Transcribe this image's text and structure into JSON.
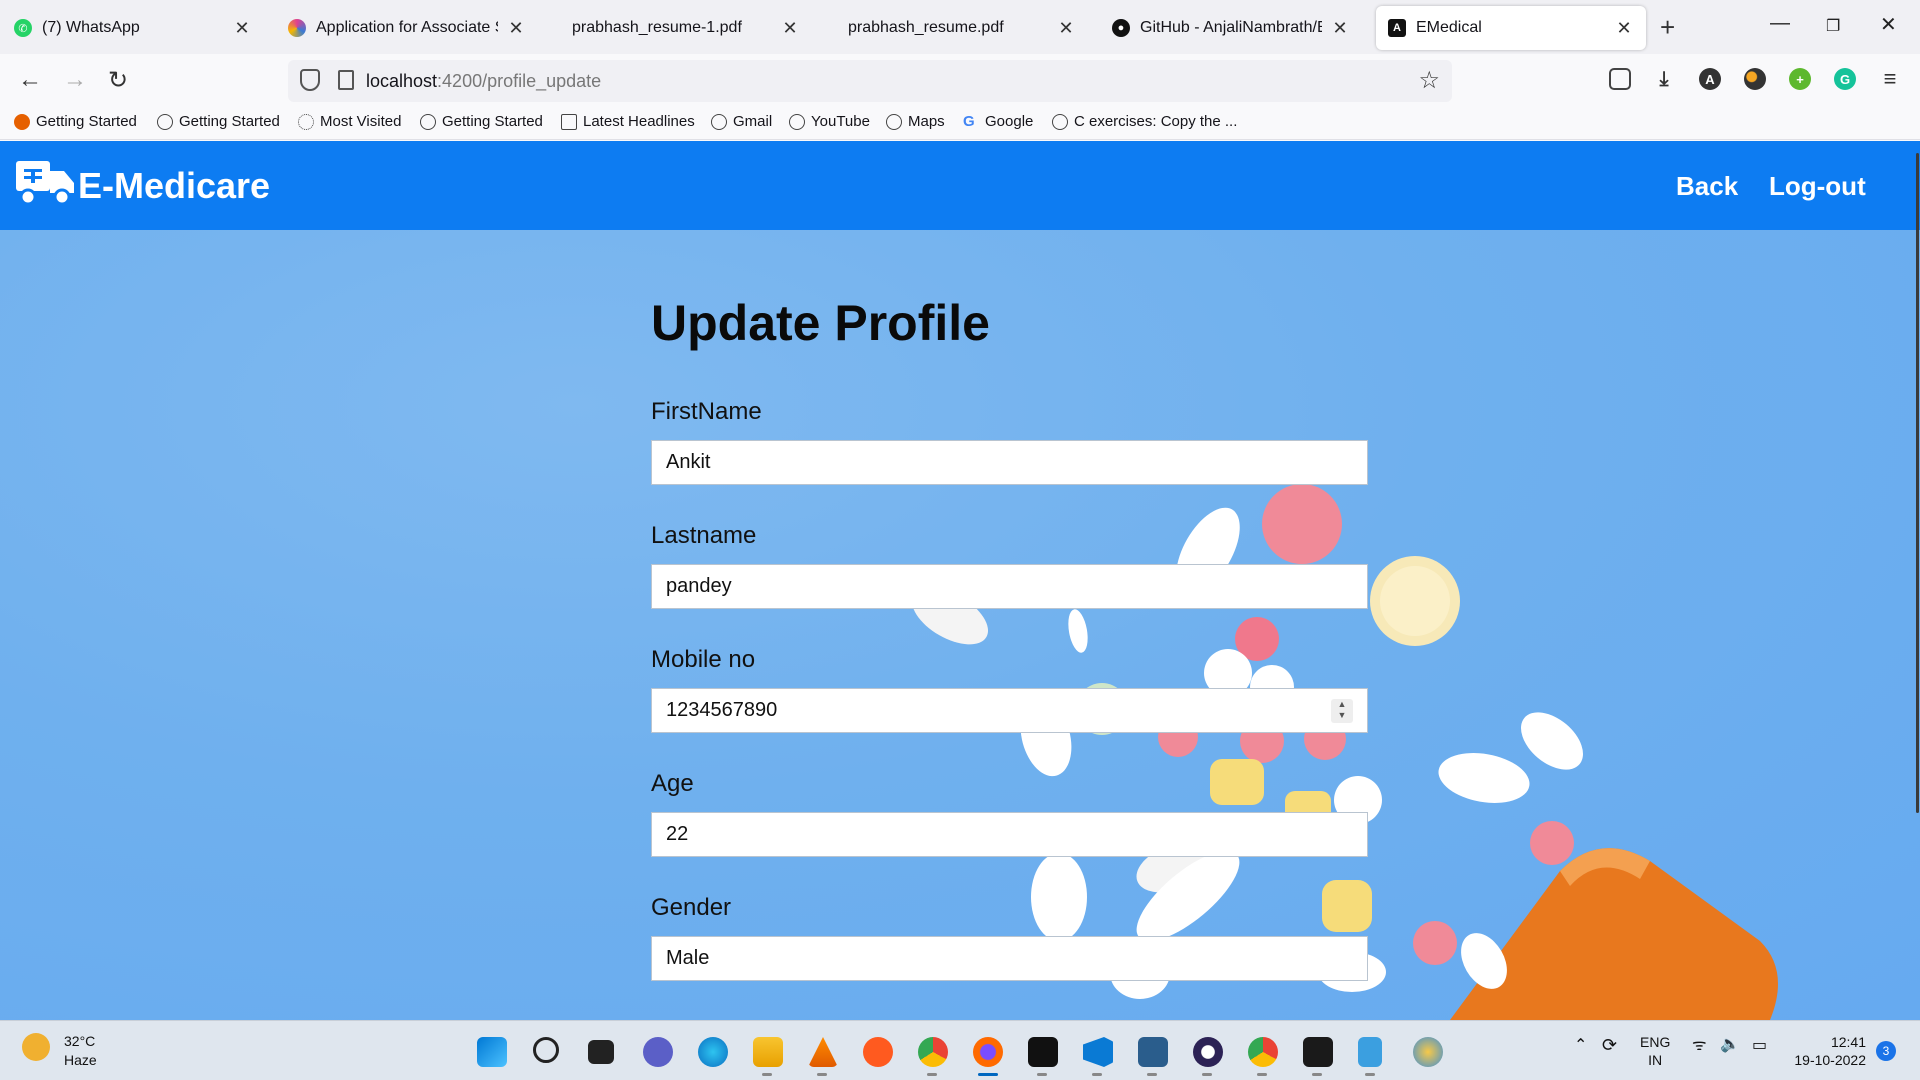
{
  "browser": {
    "tabs": [
      {
        "title": "(7) WhatsApp",
        "favicon": "whatsapp-icon",
        "color": "#25d366"
      },
      {
        "title": "Application for Associate Softw",
        "favicon": "app-icon",
        "color": "#e04090"
      },
      {
        "title": "prabhash_resume-1.pdf",
        "favicon": "pdf-icon",
        "color": ""
      },
      {
        "title": "prabhash_resume.pdf",
        "favicon": "pdf-icon",
        "color": ""
      },
      {
        "title": "GitHub - AnjaliNambrath/E-Me",
        "favicon": "github-icon",
        "color": "#111111"
      },
      {
        "title": "EMedical",
        "favicon": "angular-icon",
        "color": "#111111"
      }
    ],
    "url_host": "localhost",
    "url_path": ":4200/profile_update",
    "bookmarks": [
      "Getting Started",
      "Getting Started",
      "Most Visited",
      "Getting Started",
      "Latest Headlines",
      "Gmail",
      "YouTube",
      "Maps",
      "Google",
      "C exercises: Copy the ..."
    ]
  },
  "app": {
    "brand": "E-Medicare",
    "nav": {
      "back": "Back",
      "logout": "Log-out"
    },
    "accent": "#0d7cf2"
  },
  "form": {
    "title": "Update Profile",
    "fields": [
      {
        "label": "FirstName",
        "value": "Ankit"
      },
      {
        "label": "Lastname",
        "value": "pandey"
      },
      {
        "label": "Mobile no",
        "value": "1234567890"
      },
      {
        "label": "Age",
        "value": "22"
      },
      {
        "label": "Gender",
        "value": "Male"
      }
    ]
  },
  "taskbar": {
    "temperature": "32°C",
    "weather": "Haze",
    "lang_1": "ENG",
    "lang_2": "IN",
    "time": "12:41",
    "date": "19-10-2022",
    "notifications": "3"
  }
}
